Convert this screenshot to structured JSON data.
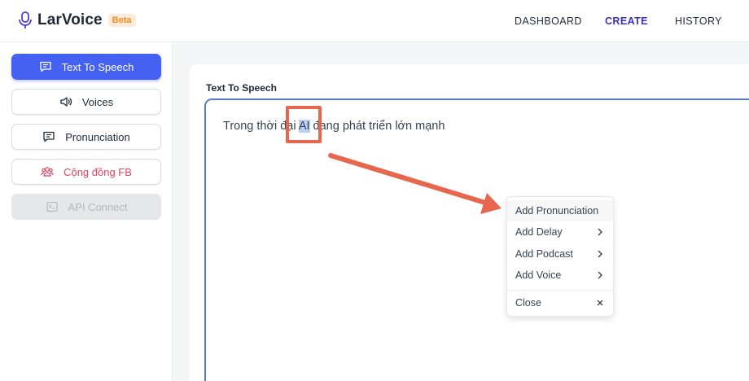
{
  "header": {
    "brand": "LarVoice",
    "badge": "Beta",
    "nav": [
      {
        "label": "DASHBOARD",
        "active": false
      },
      {
        "label": "CREATE",
        "active": true
      },
      {
        "label": "HISTORY",
        "active": false
      }
    ]
  },
  "sidebar": {
    "items": [
      {
        "label": "Text To Speech",
        "icon": "message-square-icon",
        "style": "primary"
      },
      {
        "label": "Voices",
        "icon": "speaker-icon",
        "style": "default"
      },
      {
        "label": "Pronunciation",
        "icon": "message-lines-icon",
        "style": "default"
      },
      {
        "label": "Cộng đồng FB",
        "icon": "users-icon",
        "style": "fb"
      },
      {
        "label": "API Connect",
        "icon": "terminal-icon",
        "style": "disabled"
      }
    ]
  },
  "main": {
    "section_title": "Text To Speech",
    "editor": {
      "text_before": "Trong thời đại ",
      "text_selected": "AI",
      "text_after": " đang phát triển lớn mạnh"
    }
  },
  "context_menu": {
    "items": [
      {
        "label": "Add Pronunciation",
        "has_submenu": false
      },
      {
        "label": "Add Delay",
        "has_submenu": true
      },
      {
        "label": "Add Podcast",
        "has_submenu": true
      },
      {
        "label": "Add Voice",
        "has_submenu": true
      }
    ],
    "close_label": "Close"
  },
  "colors": {
    "primary": "#4461f2",
    "nav_active": "#3b2fbf",
    "fb": "#e2435d",
    "annotation": "#e8654e",
    "editor_border": "#4d78e0",
    "selection": "#b9d0f3"
  }
}
